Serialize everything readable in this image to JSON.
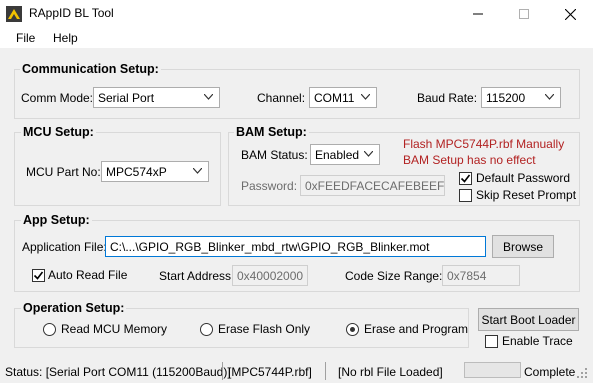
{
  "window": {
    "title": "RAppID BL Tool",
    "icon": "bl-tool-app-icon",
    "controls": [
      "minimize-icon",
      "maximize-icon",
      "close-icon"
    ]
  },
  "menu": {
    "file": "File",
    "help": "Help"
  },
  "communication": {
    "title": "Communication Setup:",
    "comm_mode_label": "Comm Mode:",
    "comm_mode_value": "Serial Port",
    "channel_label": "Channel:",
    "channel_value": "COM11",
    "baud_label": "Baud Rate:",
    "baud_value": "115200"
  },
  "mcu": {
    "title": "MCU Setup:",
    "part_label": "MCU Part No:",
    "part_value": "MPC574xP"
  },
  "bam": {
    "title": "BAM Setup:",
    "status_label": "BAM Status:",
    "status_value": "Enabled",
    "password_label": "Password:",
    "password_value": "0xFEEDFACECAFEBEEF",
    "note_line1": "Flash MPC5744P.rbf Manually",
    "note_line2": "BAM Setup has no effect",
    "default_password_label": "Default Password",
    "default_password_checked": true,
    "skip_reset_label": "Skip Reset Prompt",
    "skip_reset_checked": false
  },
  "app": {
    "title": "App Setup:",
    "file_label": "Application File:",
    "file_value": "C:\\...\\GPIO_RGB_Blinker_mbd_rtw\\GPIO_RGB_Blinker.mot",
    "browse_label": "Browse",
    "auto_read_label": "Auto Read File",
    "auto_read_checked": true,
    "start_address_label": "Start Address:",
    "start_address_value": "0x40002000",
    "code_size_label": "Code Size Range:",
    "code_size_value": "0x7854"
  },
  "operation": {
    "title": "Operation Setup:",
    "options": [
      "Read MCU Memory",
      "Erase Flash Only",
      "Erase and Program"
    ],
    "selected": "Erase and Program",
    "start_button_label": "Start Boot Loader",
    "enable_trace_label": "Enable Trace",
    "enable_trace_checked": false
  },
  "status": {
    "connection": "Status: [Serial Port COM11 (115200Baud)]",
    "file": "[MPC5744P.rbf]",
    "rbl": "[No rbl File Loaded]",
    "progress": 0,
    "state": "Complete"
  }
}
